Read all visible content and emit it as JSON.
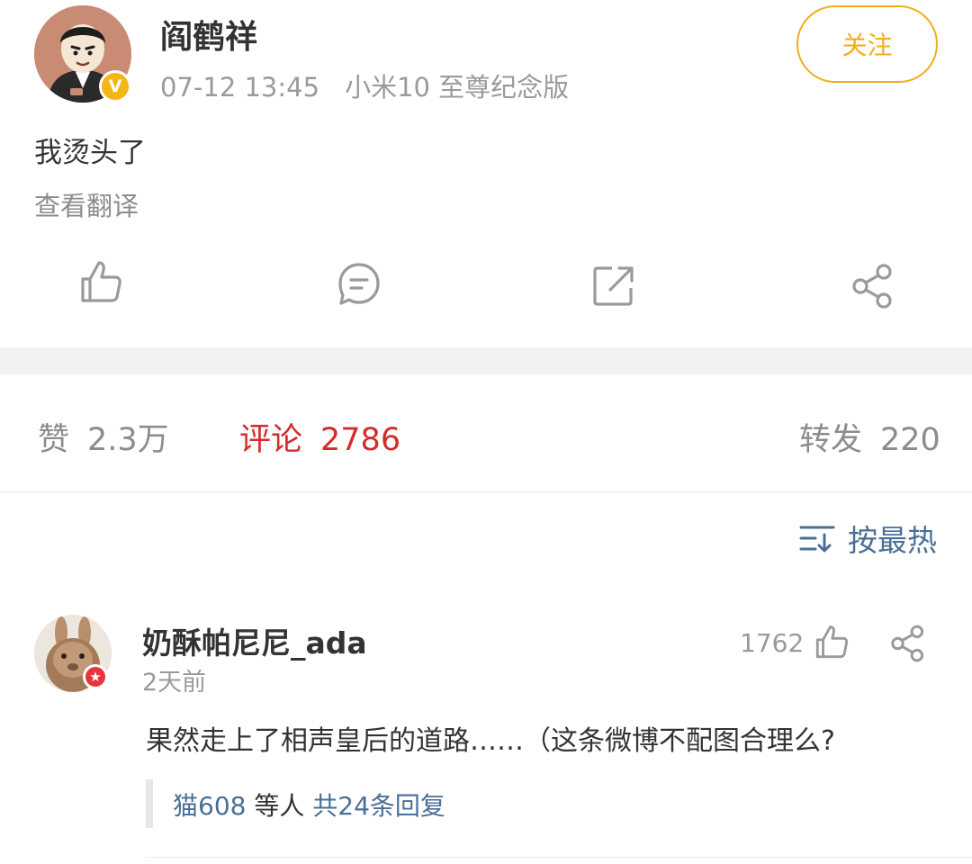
{
  "post": {
    "author": {
      "name": "阎鹤祥",
      "verified_badge_letter": "V"
    },
    "timestamp": "07-12 13:45",
    "device": "小米10 至尊纪念版",
    "follow_label": "关注",
    "text": "我烫头了",
    "translate_label": "查看翻译",
    "actions": {
      "like_icon": "thumbs-up-icon",
      "comment_icon": "comment-bubble-icon",
      "repost_icon": "repost-arrow-icon",
      "share_icon": "share-nodes-icon"
    }
  },
  "stats": {
    "likes_label": "赞",
    "likes_value": "2.3万",
    "comments_label": "评论",
    "comments_value": "2786",
    "reposts_label": "转发",
    "reposts_value": "220"
  },
  "sort": {
    "icon": "sort-lines-icon",
    "label": "按最热"
  },
  "comments": [
    {
      "user": "奶酥帕尼尼_ada",
      "time": "2天前",
      "like_count": "1762",
      "badge_symbol": "★",
      "text": "果然走上了相声皇后的道路……（这条微博不配图合理么?",
      "replies": {
        "users": "猫608",
        "others_label": "等人",
        "total_label": "共24条回复"
      }
    }
  ],
  "colors": {
    "accent_orange": "#f1ad1e",
    "comment_red": "#d22c2c",
    "link_blue": "#4a6f96",
    "muted_gray": "#9a9a9a",
    "text_dark": "#333333"
  }
}
